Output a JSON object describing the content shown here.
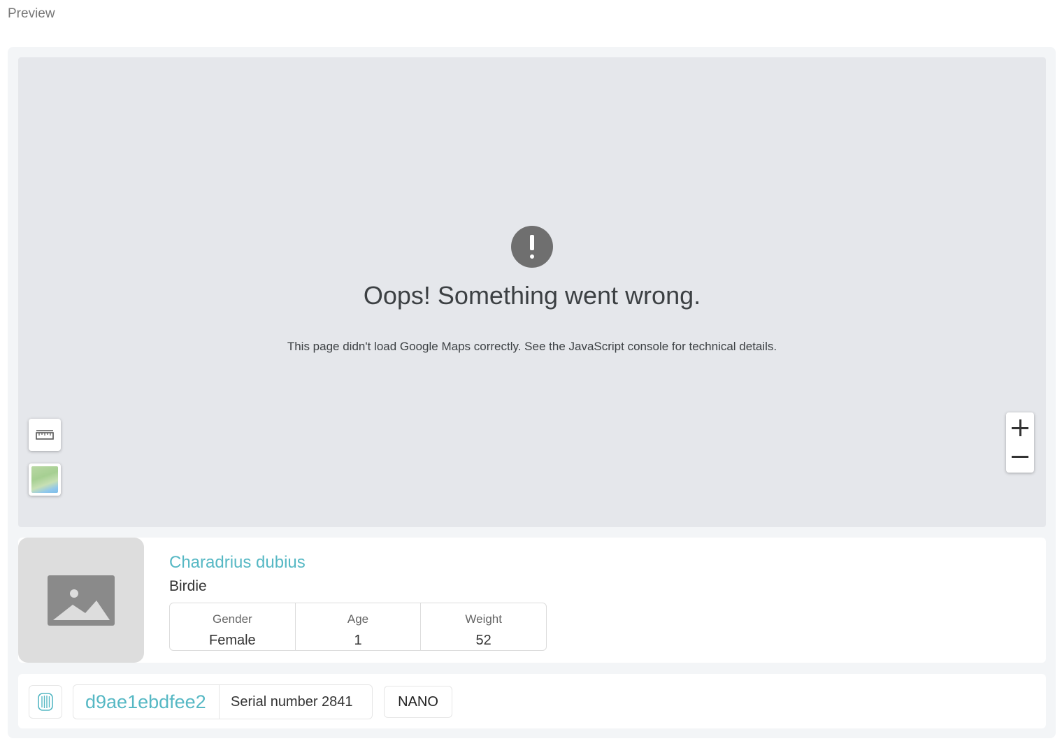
{
  "preview_label": "Preview",
  "map": {
    "error_title": "Oops! Something went wrong.",
    "error_message": "This page didn't load Google Maps correctly. See the JavaScript console for technical details.",
    "controls": {
      "measure_icon": "ruler-icon",
      "map_type_icon": "terrain-thumbnail",
      "zoom_in_icon": "plus-icon",
      "zoom_out_icon": "minus-icon"
    }
  },
  "animal": {
    "image_icon": "image-placeholder-icon",
    "species": "Charadrius dubius",
    "nickname": "Birdie",
    "stats": [
      {
        "label": "Gender",
        "value": "Female"
      },
      {
        "label": "Age",
        "value": "1"
      },
      {
        "label": "Weight",
        "value": "52"
      }
    ]
  },
  "device": {
    "icon": "tracker-device-icon",
    "id": "d9ae1ebdfee2",
    "serial": "Serial number 2841",
    "model": "NANO"
  },
  "colors": {
    "accent": "#56b8c4",
    "map_background": "#e5e7eb",
    "panel_background": "#f3f5f7"
  }
}
